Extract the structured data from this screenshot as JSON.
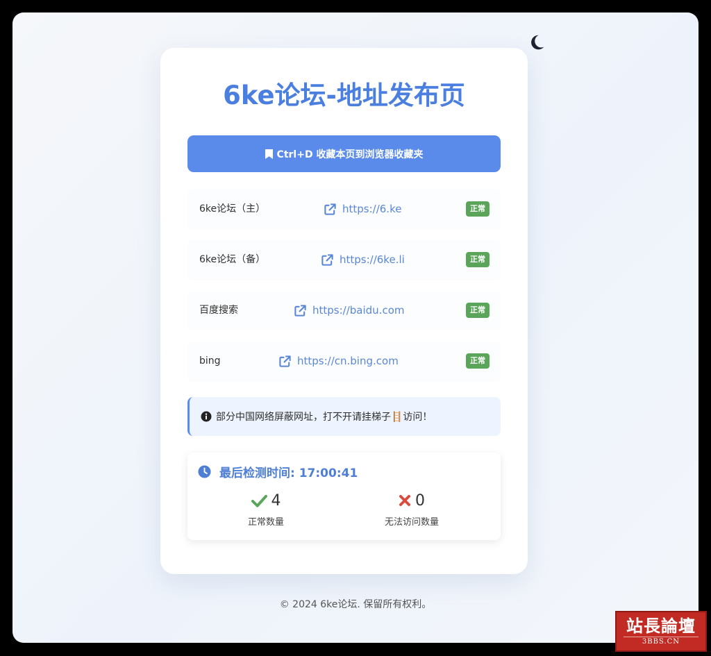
{
  "colors": {
    "accent": "#5a8bea",
    "title": "#4a7fe0",
    "link": "#5a86d6",
    "status_ok": "#5aa55a",
    "error": "#d94a3f"
  },
  "theme_toggle": {
    "icon": "moon-icon"
  },
  "header": {
    "title": "6ke论坛-地址发布页"
  },
  "bookmark": {
    "icon": "bookmark-icon",
    "label": "Ctrl+D 收藏本页到浏览器收藏夹"
  },
  "links": [
    {
      "name": "6ke论坛（主）",
      "url": "https://6.ke",
      "status": "正常",
      "icon": "external-link-icon"
    },
    {
      "name": "6ke论坛（备）",
      "url": "https://6ke.li",
      "status": "正常",
      "icon": "external-link-icon"
    },
    {
      "name": "百度搜索",
      "url": "https://baidu.com",
      "status": "正常",
      "icon": "external-link-icon"
    },
    {
      "name": "bing",
      "url": "https://cn.bing.com",
      "status": "正常",
      "icon": "external-link-icon"
    }
  ],
  "notice": {
    "icon": "info-icon",
    "text": "部分中国网络屏蔽网址，打不开请挂梯子🪜访问！"
  },
  "stats": {
    "clock_icon": "clock-icon",
    "last_check_label": "最后检测时间: 17:00:41",
    "ok_count": "4",
    "ok_label": "正常数量",
    "fail_count": "0",
    "fail_label": "无法访问数量"
  },
  "footer": {
    "text": "© 2024 6ke论坛. 保留所有权利。"
  },
  "watermark": {
    "main": "站長論壇",
    "sub": "3BBS.CN"
  }
}
